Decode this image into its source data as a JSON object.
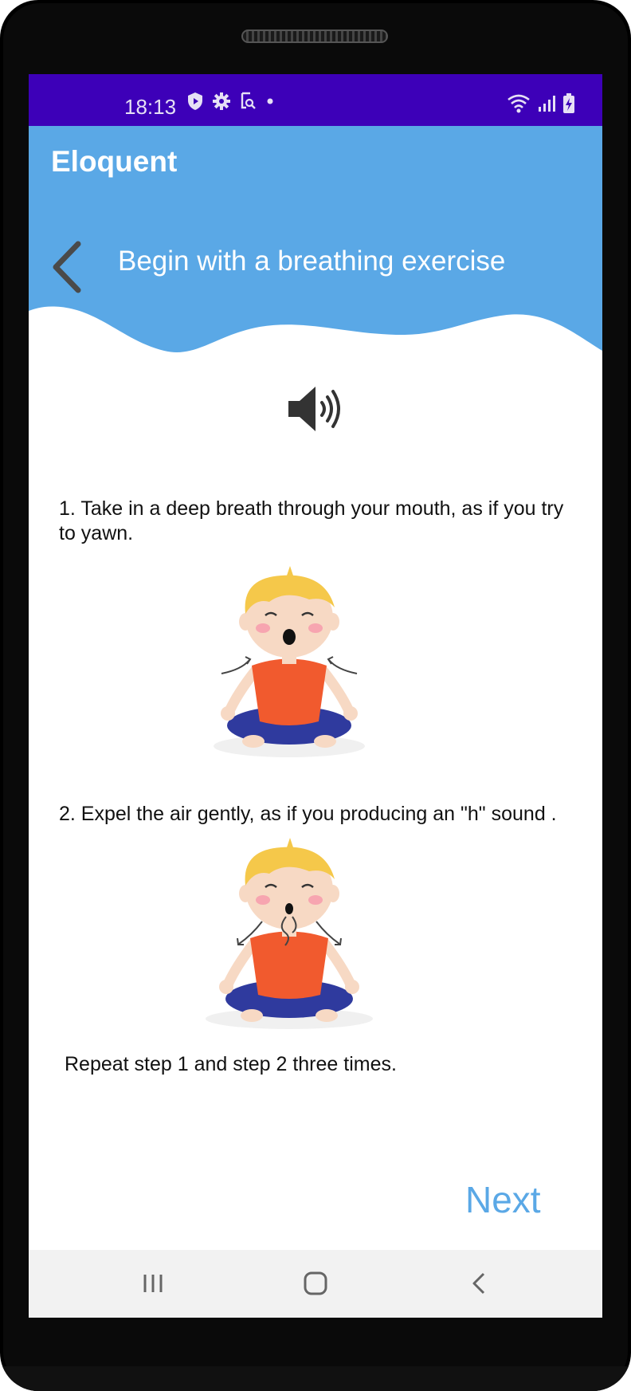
{
  "status_bar": {
    "time": "18:13",
    "left_icons": [
      "shield-play-icon",
      "gear-icon",
      "screen-search-icon",
      "dot-icon"
    ],
    "right_icons": [
      "wifi-icon",
      "signal-icon",
      "battery-charging-icon"
    ],
    "color": "#3d00b8"
  },
  "app_bar": {
    "title": "Eloquent",
    "color": "#5aa8e6"
  },
  "header": {
    "title": "Begin with a breathing exercise",
    "back_icon": "chevron-left-icon"
  },
  "audio": {
    "icon": "speaker-volume-icon"
  },
  "steps": [
    {
      "text": "1. Take in a deep breath through your mouth, as if you try to yawn.",
      "image": "child-inhaling-illustration"
    },
    {
      "text": "2. Expel the air gently, as if you producing an \"h\" sound .",
      "image": "child-exhaling-illustration"
    }
  ],
  "repeat_text": "Repeat step 1 and step 2 three times.",
  "next_label": "Next",
  "nav_bar": {
    "buttons": [
      "recent-apps-icon",
      "home-icon",
      "back-icon"
    ]
  }
}
